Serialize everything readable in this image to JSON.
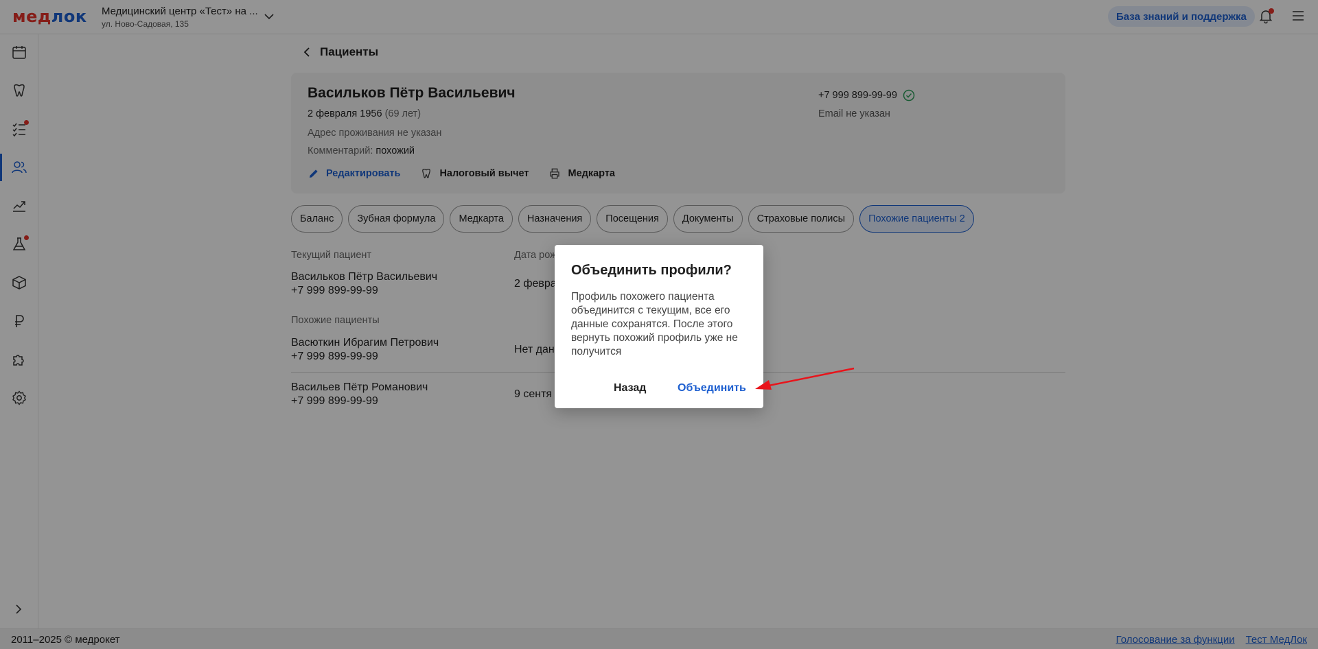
{
  "app": {
    "logo_part1": "мед",
    "logo_part2": "лок"
  },
  "header": {
    "clinic_name": "Медицинский центр «Тест» на ...",
    "clinic_address": "ул. Ново-Садовая, 135",
    "support_label": "База знаний и поддержка"
  },
  "sidebar": {
    "items": [
      {
        "icon": "calendar-icon"
      },
      {
        "icon": "tooth-icon"
      },
      {
        "icon": "task-list-icon",
        "badge": true
      },
      {
        "icon": "patients-icon",
        "active": true
      },
      {
        "icon": "analytics-icon"
      },
      {
        "icon": "lab-flask-icon",
        "badge": true
      },
      {
        "icon": "warehouse-box-icon"
      },
      {
        "icon": "ruble-icon"
      },
      {
        "icon": "integrations-puzzle-icon"
      },
      {
        "icon": "settings-gear-icon"
      }
    ]
  },
  "breadcrumb": {
    "back_label": "Пациенты"
  },
  "patient": {
    "name": "Васильков Пётр Васильевич",
    "birth_date": "2 февраля 1956",
    "age": "(69 лет)",
    "address": "Адрес проживания не указан",
    "comment_label": "Комментарий:",
    "comment_value": "похожий",
    "phone": "+7 999 899-99-99",
    "email": "Email не указан",
    "actions": {
      "edit": "Редактировать",
      "tax": "Налоговый вычет",
      "medcard": "Медкарта"
    }
  },
  "tabs": [
    "Баланс",
    "Зубная формула",
    "Медкарта",
    "Назначения",
    "Посещения",
    "Документы",
    "Страховые полисы",
    "Похожие пациенты 2"
  ],
  "similar": {
    "current_label": "Текущий пациент",
    "dob_header": "Дата рож",
    "current": {
      "name": "Васильков Пётр Васильевич",
      "phone": "+7 999 899-99-99",
      "dob": "2 февра"
    },
    "similar_label": "Похожие пациенты",
    "rows": [
      {
        "name": "Васюткин Ибрагим Петрович",
        "phone": "+7 999 899-99-99",
        "dob": "Нет дан"
      },
      {
        "name": "Васильев Пётр Романович",
        "phone": "+7 999 899-99-99",
        "dob": "9 сентя"
      }
    ]
  },
  "dialog": {
    "title": "Объединить профили?",
    "body": "Профиль похожего пациента объединится с текущим, все его данные сохранятся. После этого вернуть похожий профиль уже не получится",
    "cancel": "Назад",
    "confirm": "Объединить"
  },
  "footer": {
    "copyright": "2011–2025 © медрокет",
    "link_vote": "Голосование за функции",
    "link_test": "Тест МедЛок"
  },
  "colors": {
    "accent": "#1d5fd0",
    "brand_red": "#e5332a",
    "overlay": "rgba(0,0,0,0.42)"
  }
}
